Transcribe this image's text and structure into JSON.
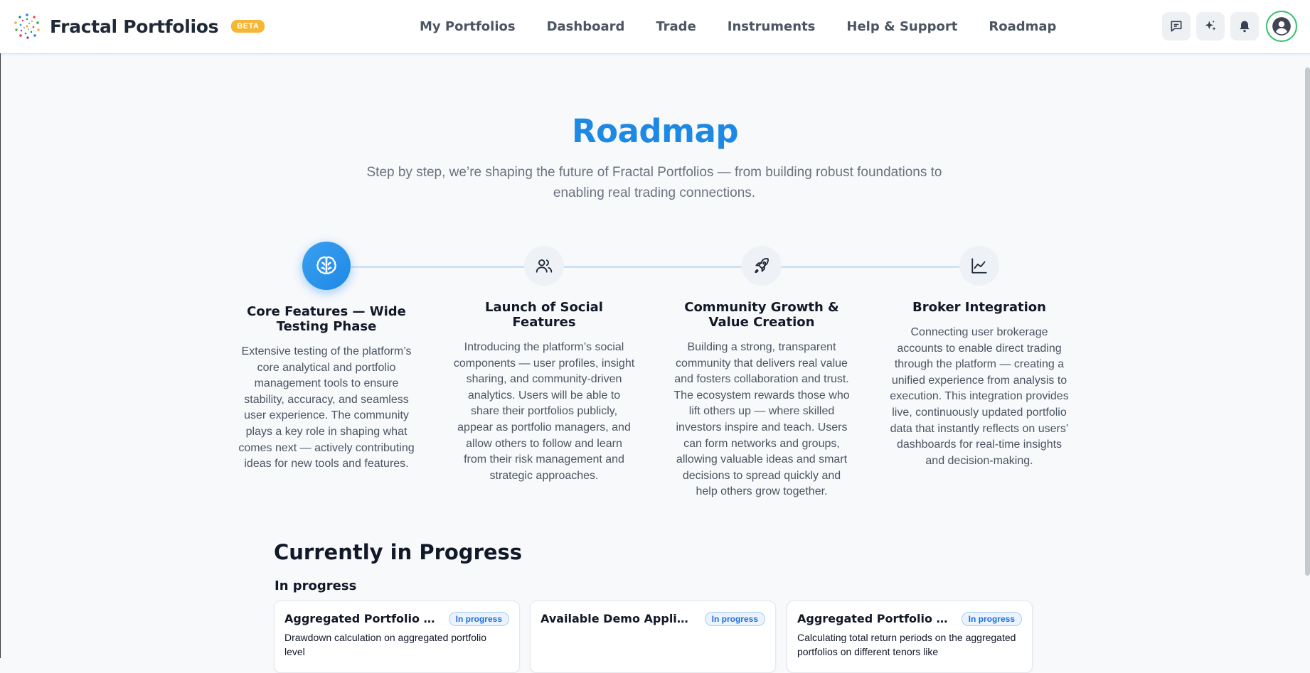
{
  "header": {
    "brand": "Fractal Portfolios",
    "badge": "BETA",
    "nav": [
      "My Portfolios",
      "Dashboard",
      "Trade",
      "Instruments",
      "Help & Support",
      "Roadmap"
    ]
  },
  "hero": {
    "title": "Roadmap",
    "subtitle": "Step by step, we’re shaping the future of Fractal Portfolios — from building robust foundations to enabling real trading connections."
  },
  "steps": [
    {
      "title": "Core Features — Wide Testing Phase",
      "description": "Extensive testing of the platform’s core analytical and portfolio management tools to ensure stability, accuracy, and seamless user experience. The community plays a key role in shaping what comes next — actively contributing ideas for new tools and features.",
      "icon": "brain-icon",
      "active": true
    },
    {
      "title": "Launch of Social Features",
      "description": "Introducing the platform’s social components — user profiles, insight sharing, and community-driven analytics. Users will be able to share their portfolios publicly, appear as portfolio managers, and allow others to follow and learn from their risk management and strategic approaches.",
      "icon": "users-icon",
      "active": false
    },
    {
      "title": "Community Growth & Value Creation",
      "description": "Building a strong, transparent community that delivers real value and fosters collaboration and trust. The ecosystem rewards those who lift others up — where skilled investors inspire and teach. Users can form networks and groups, allowing valuable ideas and smart decisions to spread quickly and help others grow together.",
      "icon": "rocket-icon",
      "active": false
    },
    {
      "title": "Broker Integration",
      "description": "Connecting user brokerage accounts to enable direct trading through the platform — creating a unified experience from analysis to execution. This integration provides live, continuously updated portfolio data that instantly reflects on users’ dashboards for real-time insights and decision-making.",
      "icon": "line-chart-icon",
      "active": false
    }
  ],
  "progress": {
    "heading": "Currently in Progress",
    "subheading": "In progress",
    "cards": [
      {
        "title": "Aggregated Portfolio Drawdown",
        "badge": "In progress",
        "description": "Drawdown calculation on aggregated portfolio level"
      },
      {
        "title": "Available Demo Applications",
        "badge": "In progress",
        "description": ""
      },
      {
        "title": "Aggregated Portfolio Total Return",
        "badge": "In progress",
        "description": "Calculating total return periods on the aggregated portfolios on different tenors like"
      }
    ]
  },
  "colors": {
    "accent": "#1e88e5",
    "beta_badge": "#f5b633",
    "avatar_ring": "#34c06a"
  },
  "icons": {
    "logo": "fractal-dots-logo",
    "tools": [
      "chat-icon",
      "sparkles-icon",
      "bell-icon",
      "user-icon"
    ]
  }
}
